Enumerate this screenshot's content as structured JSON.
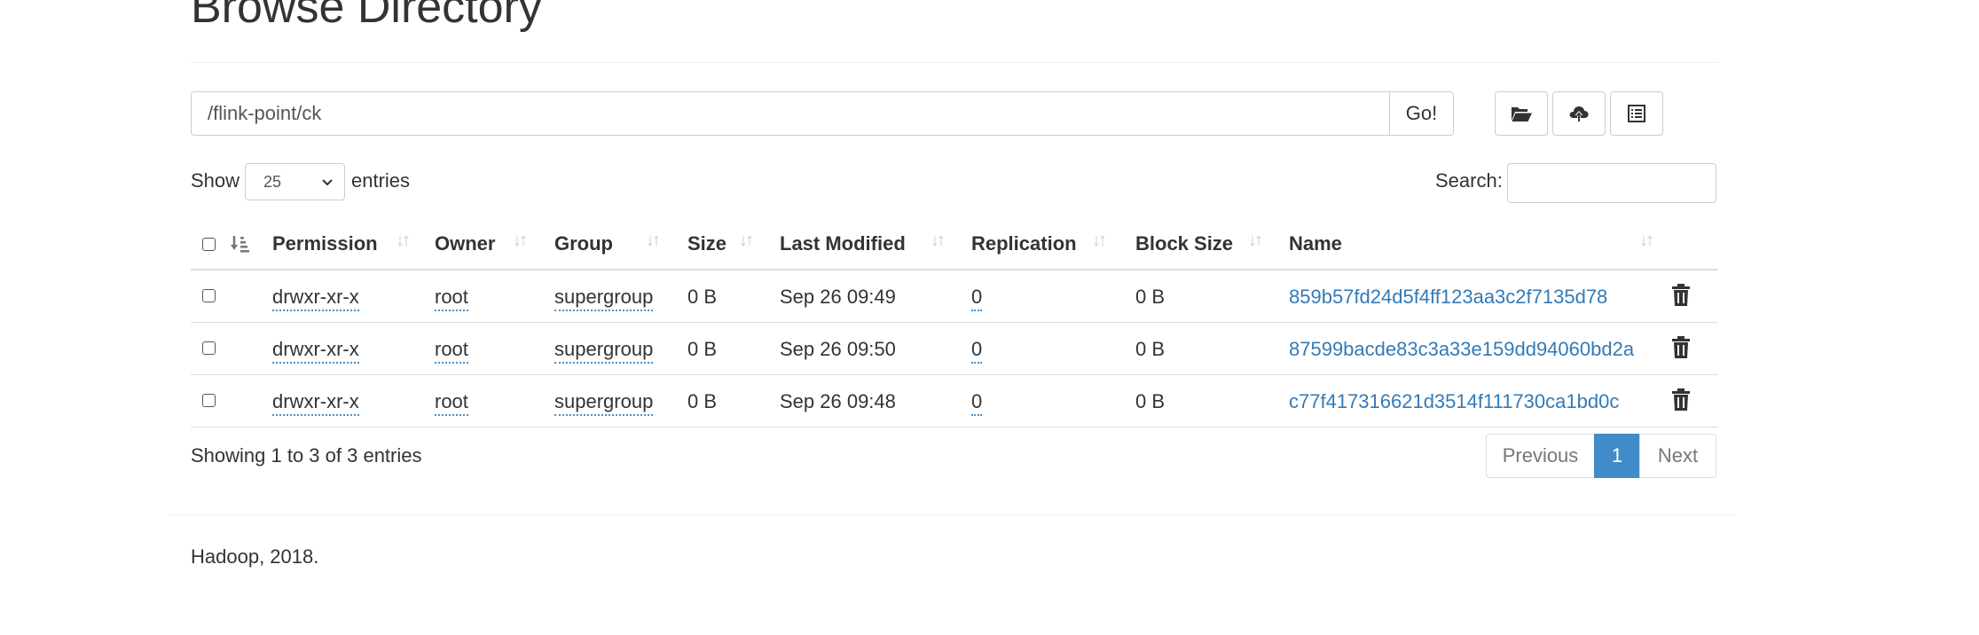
{
  "page": {
    "title": "Browse Directory"
  },
  "toolbar": {
    "path_value": "/flink-point/ck",
    "go_label": "Go!",
    "icons": [
      "folder-open-icon",
      "cloud-upload-icon",
      "list-alt-icon"
    ]
  },
  "controls": {
    "show_label": "Show",
    "entries_value": "25",
    "entries_label": "entries",
    "search_label": "Search:",
    "search_value": ""
  },
  "table": {
    "columns": [
      "Permission",
      "Owner",
      "Group",
      "Size",
      "Last Modified",
      "Replication",
      "Block Size",
      "Name"
    ],
    "rows": [
      {
        "permission": "drwxr-xr-x",
        "owner": "root",
        "group": "supergroup",
        "size": "0 B",
        "last_modified": "Sep 26 09:49",
        "replication": "0",
        "block_size": "0 B",
        "name": "859b57fd24d5f4ff123aa3c2f7135d78"
      },
      {
        "permission": "drwxr-xr-x",
        "owner": "root",
        "group": "supergroup",
        "size": "0 B",
        "last_modified": "Sep 26 09:50",
        "replication": "0",
        "block_size": "0 B",
        "name": "87599bacde83c3a33e159dd94060bd2a"
      },
      {
        "permission": "drwxr-xr-x",
        "owner": "root",
        "group": "supergroup",
        "size": "0 B",
        "last_modified": "Sep 26 09:48",
        "replication": "0",
        "block_size": "0 B",
        "name": "c77f417316621d3514f111730ca1bd0c"
      }
    ]
  },
  "pagination": {
    "info": "Showing 1 to 3 of 3 entries",
    "previous_label": "Previous",
    "current_page": "1",
    "next_label": "Next"
  },
  "footer": {
    "text": "Hadoop, 2018."
  },
  "colors": {
    "link": "#337ab7",
    "active_page": "#428bca",
    "border": "#dddddd"
  }
}
